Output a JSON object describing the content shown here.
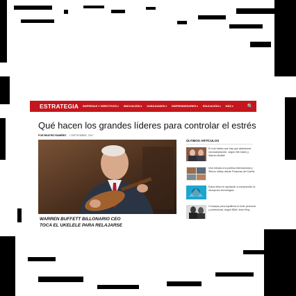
{
  "nav": {
    "brand": "ESTRATEGIA",
    "items": [
      {
        "label": "EMPRESAS Y DIRECTIVOS"
      },
      {
        "label": "INNOVACIÓN"
      },
      {
        "label": "HABILIDADES"
      },
      {
        "label": "EMPRENDEDORES"
      },
      {
        "label": "EDUCACIÓN"
      },
      {
        "label": "MÁS"
      }
    ],
    "search_icon": "🔍",
    "color": "#c4161c"
  },
  "article": {
    "title": "Qué hacen los grandes líderes para controlar el estrés",
    "author": "POR BEATRIZ RAMÍREZ",
    "date": "1 SEPTIEMBRE, 2017",
    "caption_line1": "WARREN BUFFETT  BILLONARIO CEO",
    "caption_line2": "TOCA EL UKELELE PARA RELAJARSE"
  },
  "sidebar": {
    "title": "ÚLTIMOS ARTÍCULOS",
    "items": [
      {
        "text": "El real hábito que hay que abandonar necesariamente, según Bill Gates y Warren Buffett"
      },
      {
        "text": "Una mirada a la política internacional y Silicon Valley desde Finanzas del Caribe"
      },
      {
        "text": "Estos libros te ayudarán a comprender la disrupción tecnológica"
      },
      {
        "text": "Consejos para equilibrar el éxito personal y profesional, según Billie Jean King"
      }
    ]
  }
}
